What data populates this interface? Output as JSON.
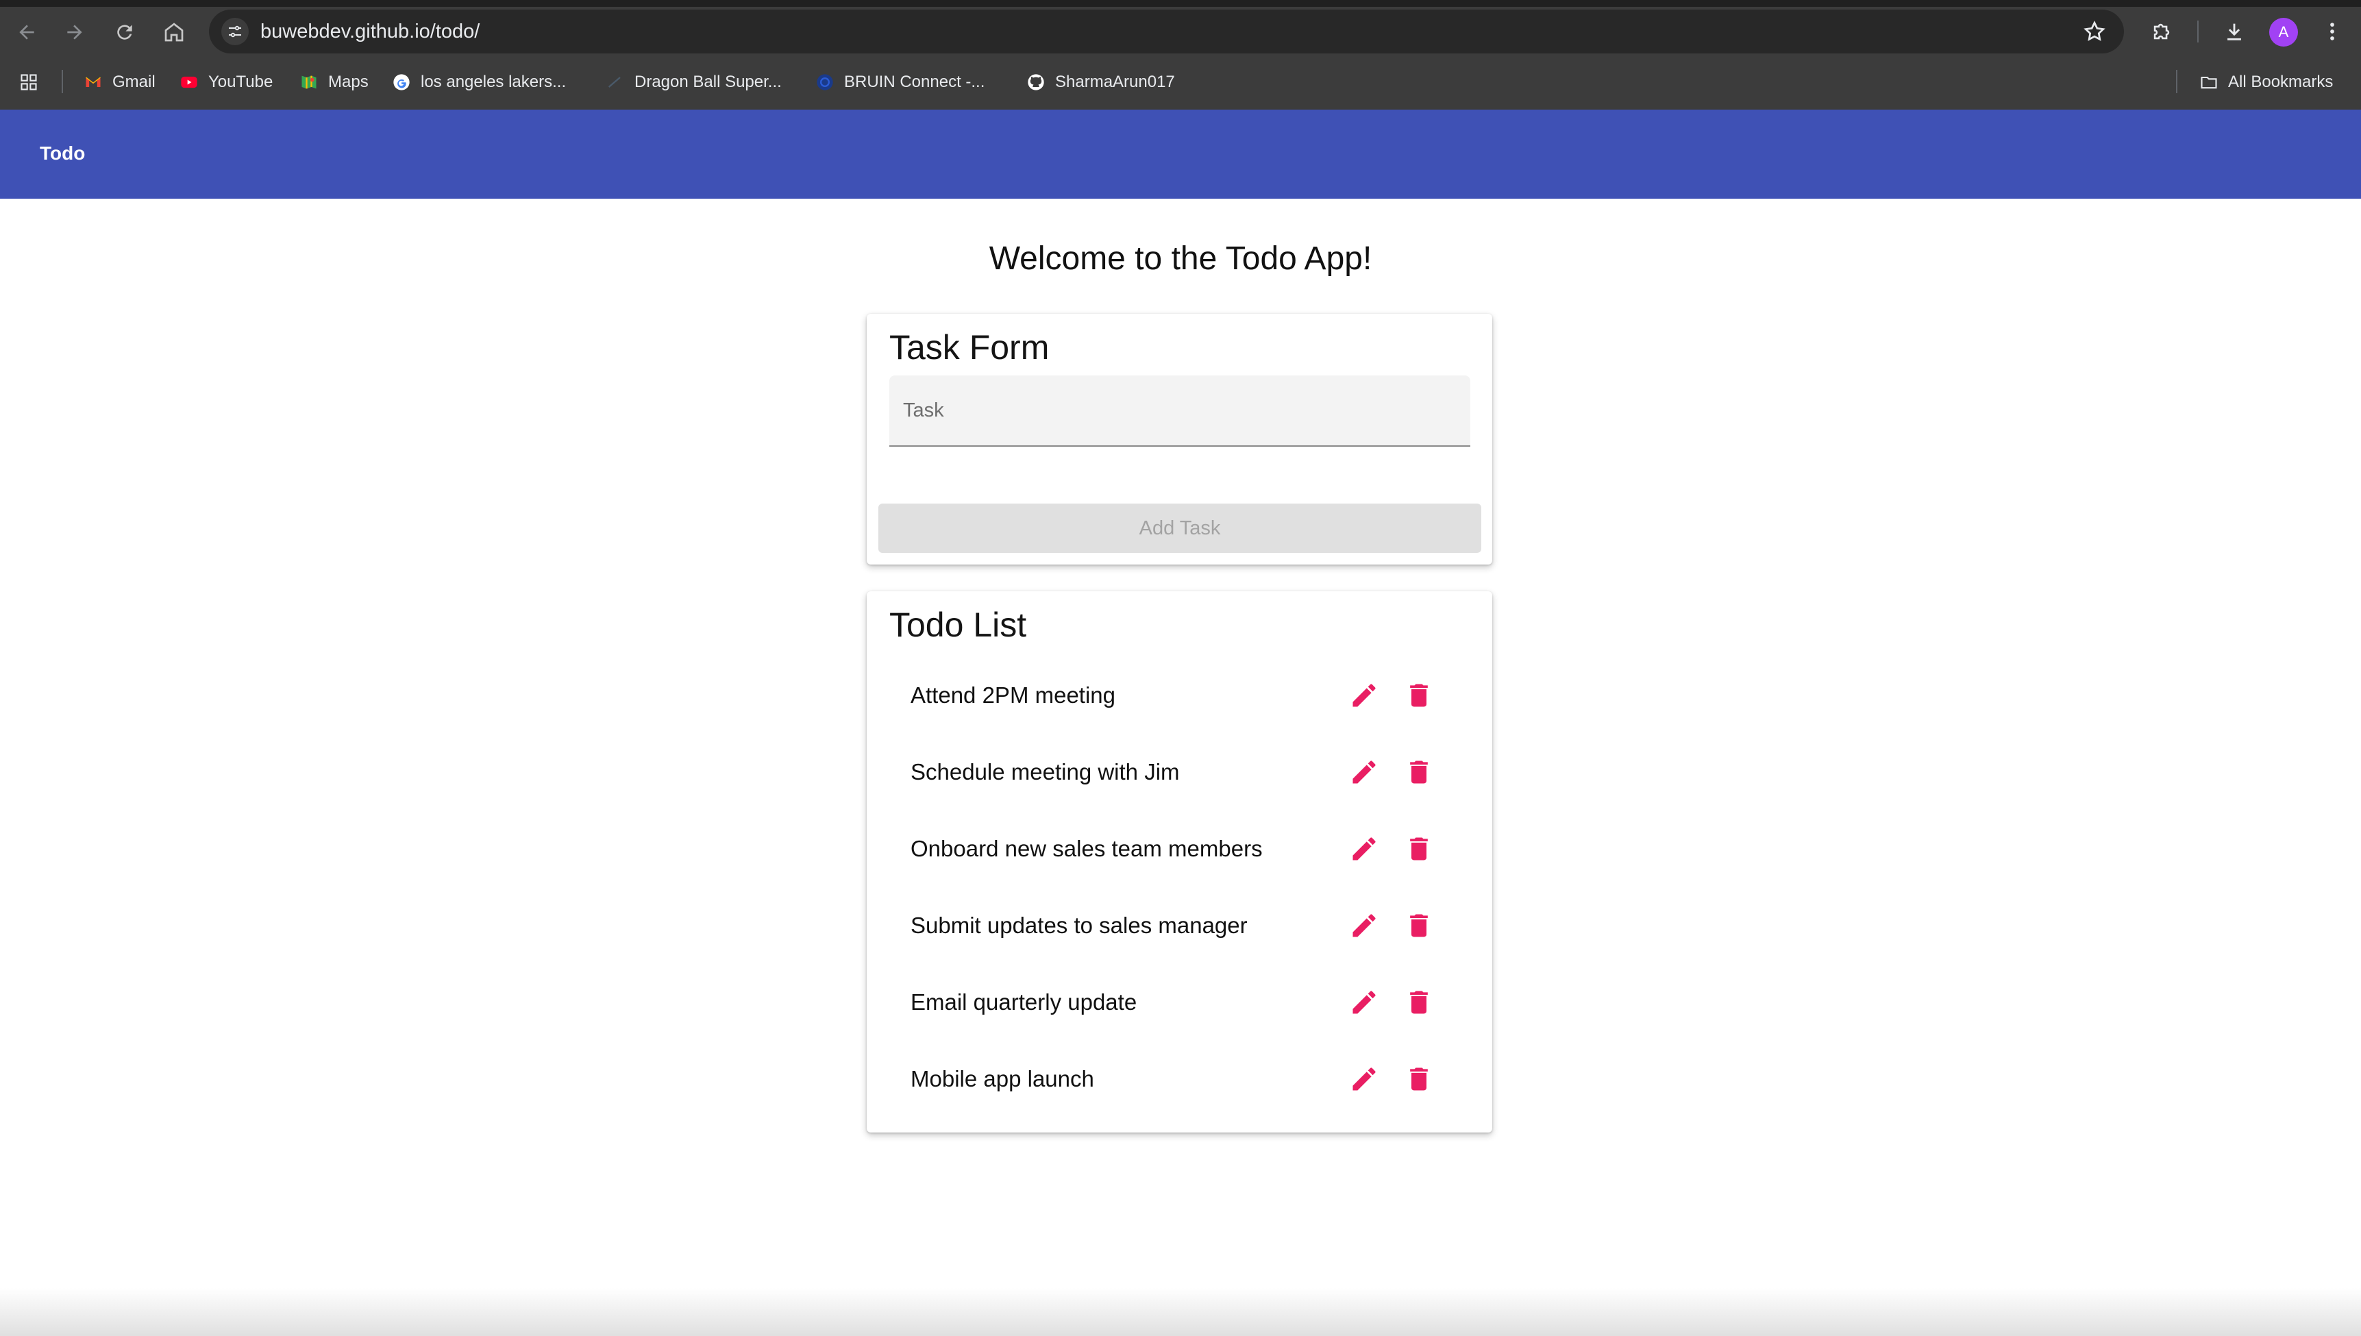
{
  "browser": {
    "url": "buwebdev.github.io/todo/",
    "avatar_letter": "A",
    "bookmarks": [
      {
        "label": "Gmail",
        "icon": "gmail-icon"
      },
      {
        "label": "YouTube",
        "icon": "youtube-icon"
      },
      {
        "label": "Maps",
        "icon": "maps-icon"
      },
      {
        "label": "los angeles lakers...",
        "icon": "google-icon"
      },
      {
        "label": "Dragon Ball Super...",
        "icon": "dragonball-icon"
      },
      {
        "label": "BRUIN Connect -...",
        "icon": "bruin-icon"
      },
      {
        "label": "SharmaArun017",
        "icon": "github-icon"
      }
    ],
    "all_bookmarks_label": "All Bookmarks"
  },
  "app": {
    "title": "Todo",
    "welcome": "Welcome to the Todo App!",
    "form": {
      "title": "Task Form",
      "task_placeholder": "Task",
      "task_value": "",
      "add_button": "Add Task"
    },
    "list": {
      "title": "Todo List",
      "items": [
        {
          "text": "Attend 2PM meeting"
        },
        {
          "text": "Schedule meeting with Jim"
        },
        {
          "text": "Onboard new sales team members"
        },
        {
          "text": "Submit updates to sales manager"
        },
        {
          "text": "Email quarterly update"
        },
        {
          "text": "Mobile app launch"
        }
      ]
    }
  },
  "colors": {
    "appbar": "#3f51b5",
    "accent_pink": "#e91e63",
    "chrome_bg": "#3c3c3c"
  }
}
